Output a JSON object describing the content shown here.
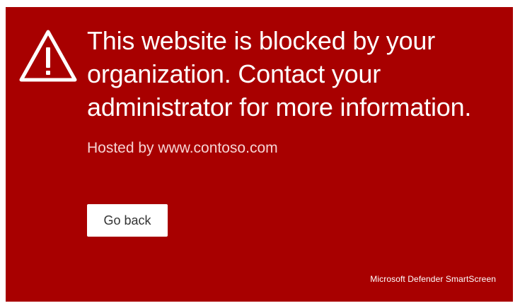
{
  "page": {
    "headline": "This website is blocked by your organization. Contact your administrator for more information.",
    "hosted_by": "Hosted by www.contoso.com",
    "go_back_label": "Go back",
    "branding": "Microsoft Defender SmartScreen"
  },
  "icons": {
    "warning": "warning-triangle-icon"
  },
  "colors": {
    "panel_background": "#a80000",
    "text_primary": "#ffffff",
    "button_background": "#ffffff",
    "button_text": "#333333"
  }
}
